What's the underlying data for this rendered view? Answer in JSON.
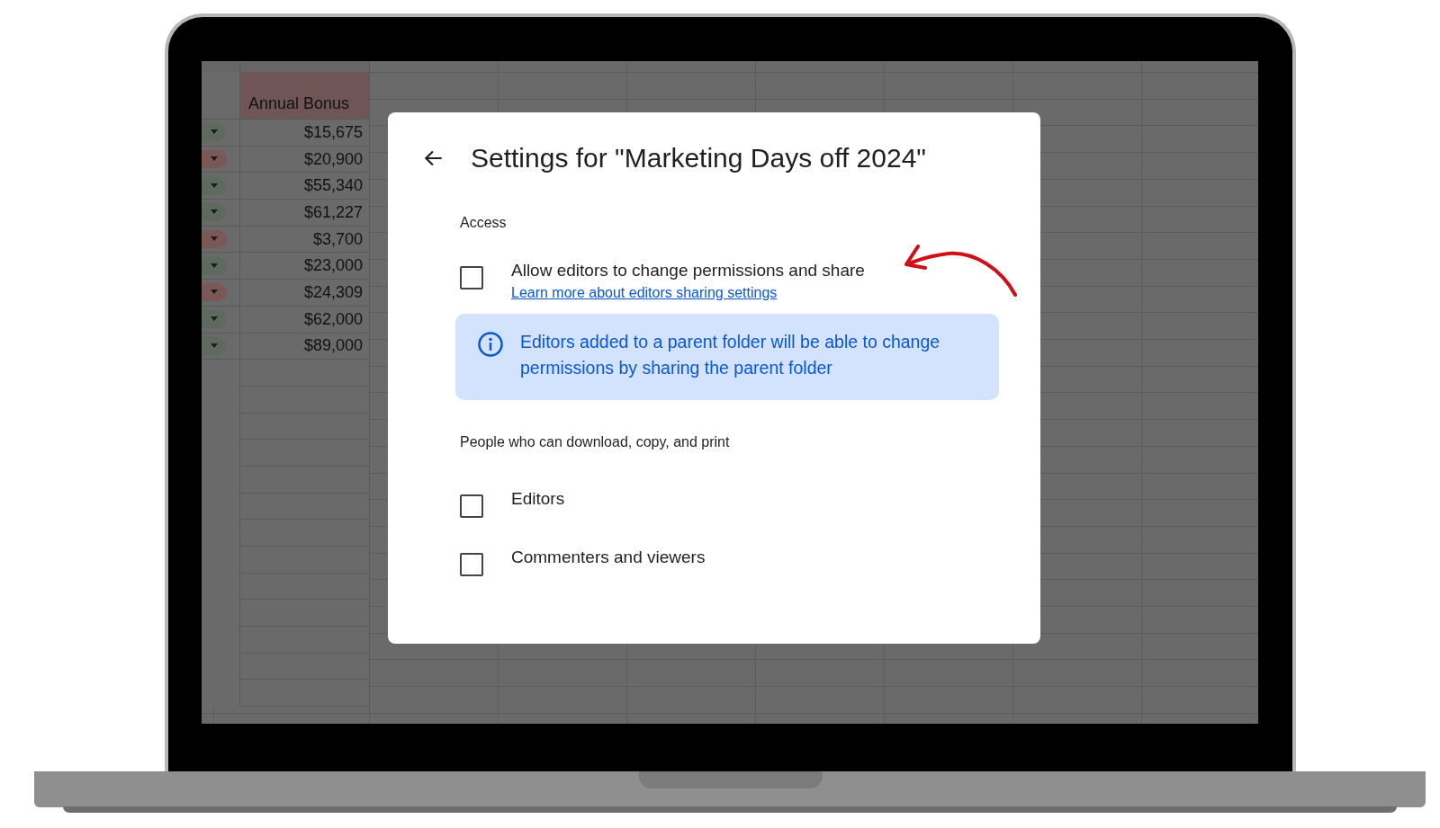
{
  "sheet": {
    "header": "Annual Bonus",
    "rows": [
      {
        "value": "$15,675",
        "color": "#5f6a5f"
      },
      {
        "value": "$20,900",
        "color": "#7a5858"
      },
      {
        "value": "$55,340",
        "color": "#5f6a5f"
      },
      {
        "value": "$61,227",
        "color": "#5f6a5f"
      },
      {
        "value": "$3,700",
        "color": "#7a5858"
      },
      {
        "value": "$23,000",
        "color": "#5f6a5f"
      },
      {
        "value": "$24,309",
        "color": "#7a5858"
      },
      {
        "value": "$62,000",
        "color": "#5f6a5f"
      },
      {
        "value": "$89,000",
        "color": "#5f6a5f"
      }
    ]
  },
  "dialog": {
    "title": "Settings for \"Marketing Days off 2024\"",
    "sections": [
      {
        "heading": "Access",
        "options": [
          {
            "label": "Allow editors to change permissions and share",
            "link": "Learn more about editors sharing settings",
            "checked": false
          }
        ],
        "info": "Editors added to a parent folder will be able to change permissions by sharing the parent folder"
      },
      {
        "heading": "People who can download, copy, and print",
        "options": [
          {
            "label": "Editors",
            "checked": false
          },
          {
            "label": "Commenters and viewers",
            "checked": false
          }
        ]
      }
    ]
  }
}
